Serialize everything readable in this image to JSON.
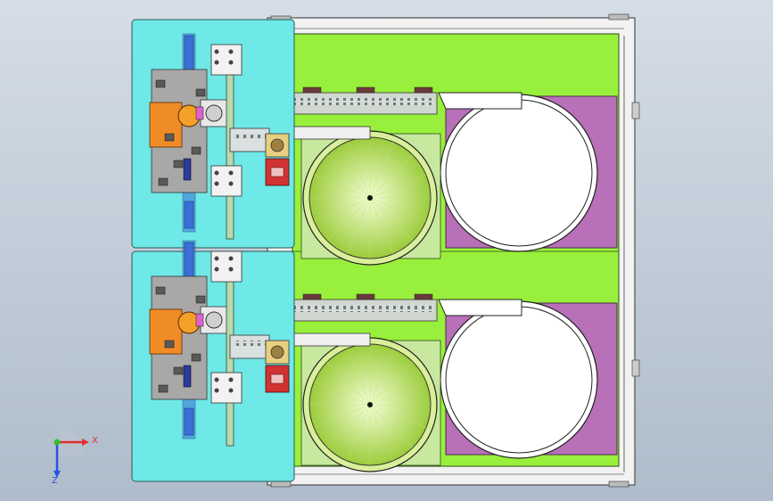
{
  "viewport": {
    "background_top": "#d5dde6",
    "background_bottom": "#aebccb"
  },
  "colors": {
    "panel_cyan": "#6fe8e8",
    "base_green": "#99f03c",
    "frame_white": "#f2f2f2",
    "purple_plate": "#b870b8",
    "feeder_disc_center": "#f4ffd8",
    "feeder_disc_edge": "#9ccc3c",
    "orange_part": "#f08c28",
    "red_block": "#d23232",
    "rail_blue": "#3b6fd6",
    "gray_plate": "#a8a8a8",
    "dark_part": "#5a5a5a",
    "axis_x": "#e03030",
    "axis_y": "#2ec02e",
    "axis_z": "#2a52e0"
  },
  "triad": {
    "x_label": "X",
    "z_label": "Z",
    "x_icon": "axis-x-arrow-icon",
    "z_icon": "axis-z-arrow-icon"
  },
  "assembly": {
    "station_count": 2
  }
}
